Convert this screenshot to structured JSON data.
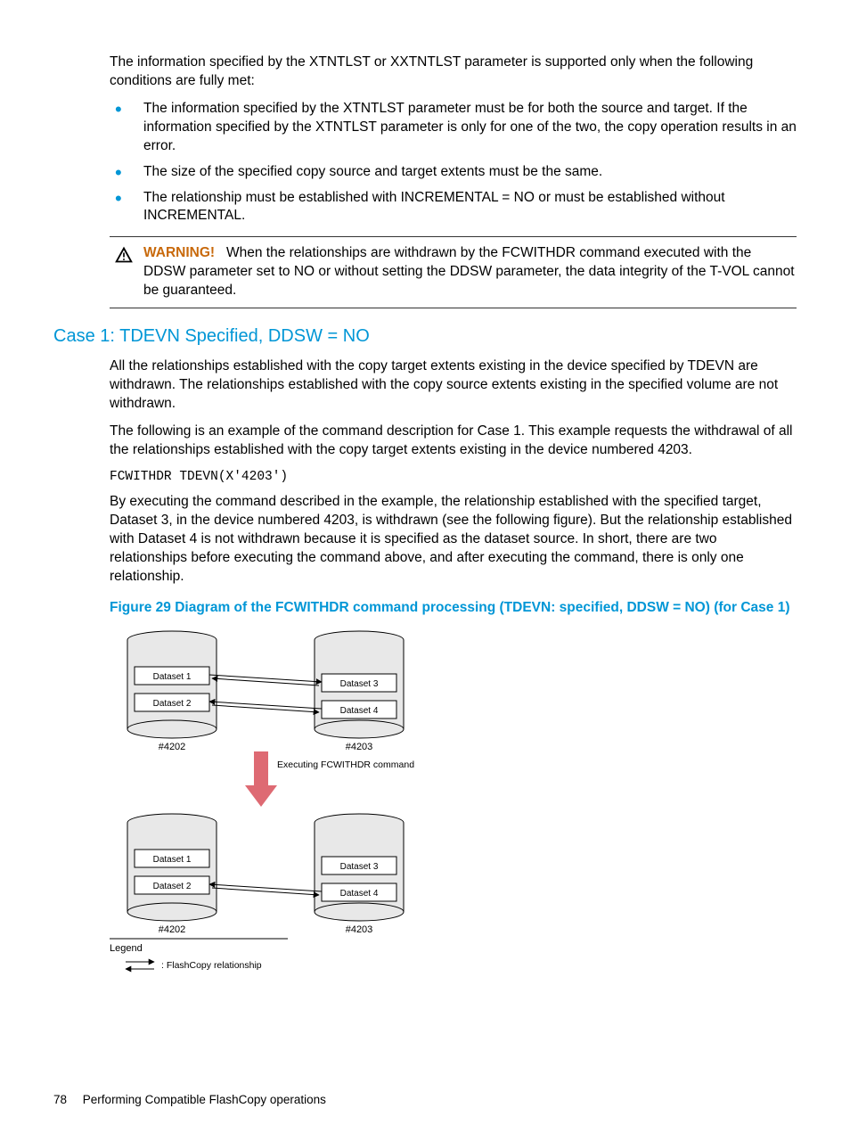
{
  "intro_para": "The information specified by the XTNTLST or XXTNTLST parameter is supported only when the following conditions are fully met:",
  "bullets": [
    "The information specified by the XTNTLST parameter must be for both the source and target. If the information specified by the XTNTLST parameter is only for one of the two, the copy operation results in an error.",
    "The size of the specified copy source and target extents must be the same.",
    "The relationship must be established with INCREMENTAL = NO or must be established without INCREMENTAL."
  ],
  "warning": {
    "label": "WARNING!",
    "text": "When the relationships are withdrawn by the FCWITHDR command executed with the DDSW parameter set to NO or without setting the DDSW parameter, the data integrity of the T-VOL cannot be guaranteed."
  },
  "case1": {
    "heading": "Case 1: TDEVN Specified, DDSW = NO",
    "p1": "All the relationships established with the copy target extents existing in the device specified by TDEVN are withdrawn. The relationships established with the copy source extents existing in the specified volume are not withdrawn.",
    "p2": "The following is an example of the command description for Case 1. This example requests the withdrawal of all the relationships established with the copy target extents existing in the device numbered 4203.",
    "code": "FCWITHDR TDEVN(X'4203')",
    "p3": "By executing the command described in the example, the relationship established with the specified target, Dataset 3, in the device numbered 4203, is withdrawn (see the following figure). But the relationship established with Dataset 4 is not withdrawn because it is specified as the dataset source. In short, there are two relationships before executing the command above, and after executing the command, there is only one relationship."
  },
  "figure": {
    "title": "Figure 29 Diagram of the FCWITHDR command processing (TDEVN: specified, DDSW = NO) (for Case 1)",
    "top": {
      "left_vol": "#4202",
      "right_vol": "#4203",
      "datasets_left": [
        "Dataset 1",
        "Dataset 2"
      ],
      "datasets_right": [
        "Dataset 3",
        "Dataset 4"
      ]
    },
    "middle_text": "Executing FCWITHDR command",
    "bottom": {
      "left_vol": "#4202",
      "right_vol": "#4203",
      "datasets_left": [
        "Dataset 1",
        "Dataset 2"
      ],
      "datasets_right": [
        "Dataset 3",
        "Dataset 4"
      ]
    },
    "legend": {
      "title": "Legend",
      "relationship": ": FlashCopy relationship"
    }
  },
  "footer": {
    "page": "78",
    "section": "Performing Compatible FlashCopy operations"
  }
}
